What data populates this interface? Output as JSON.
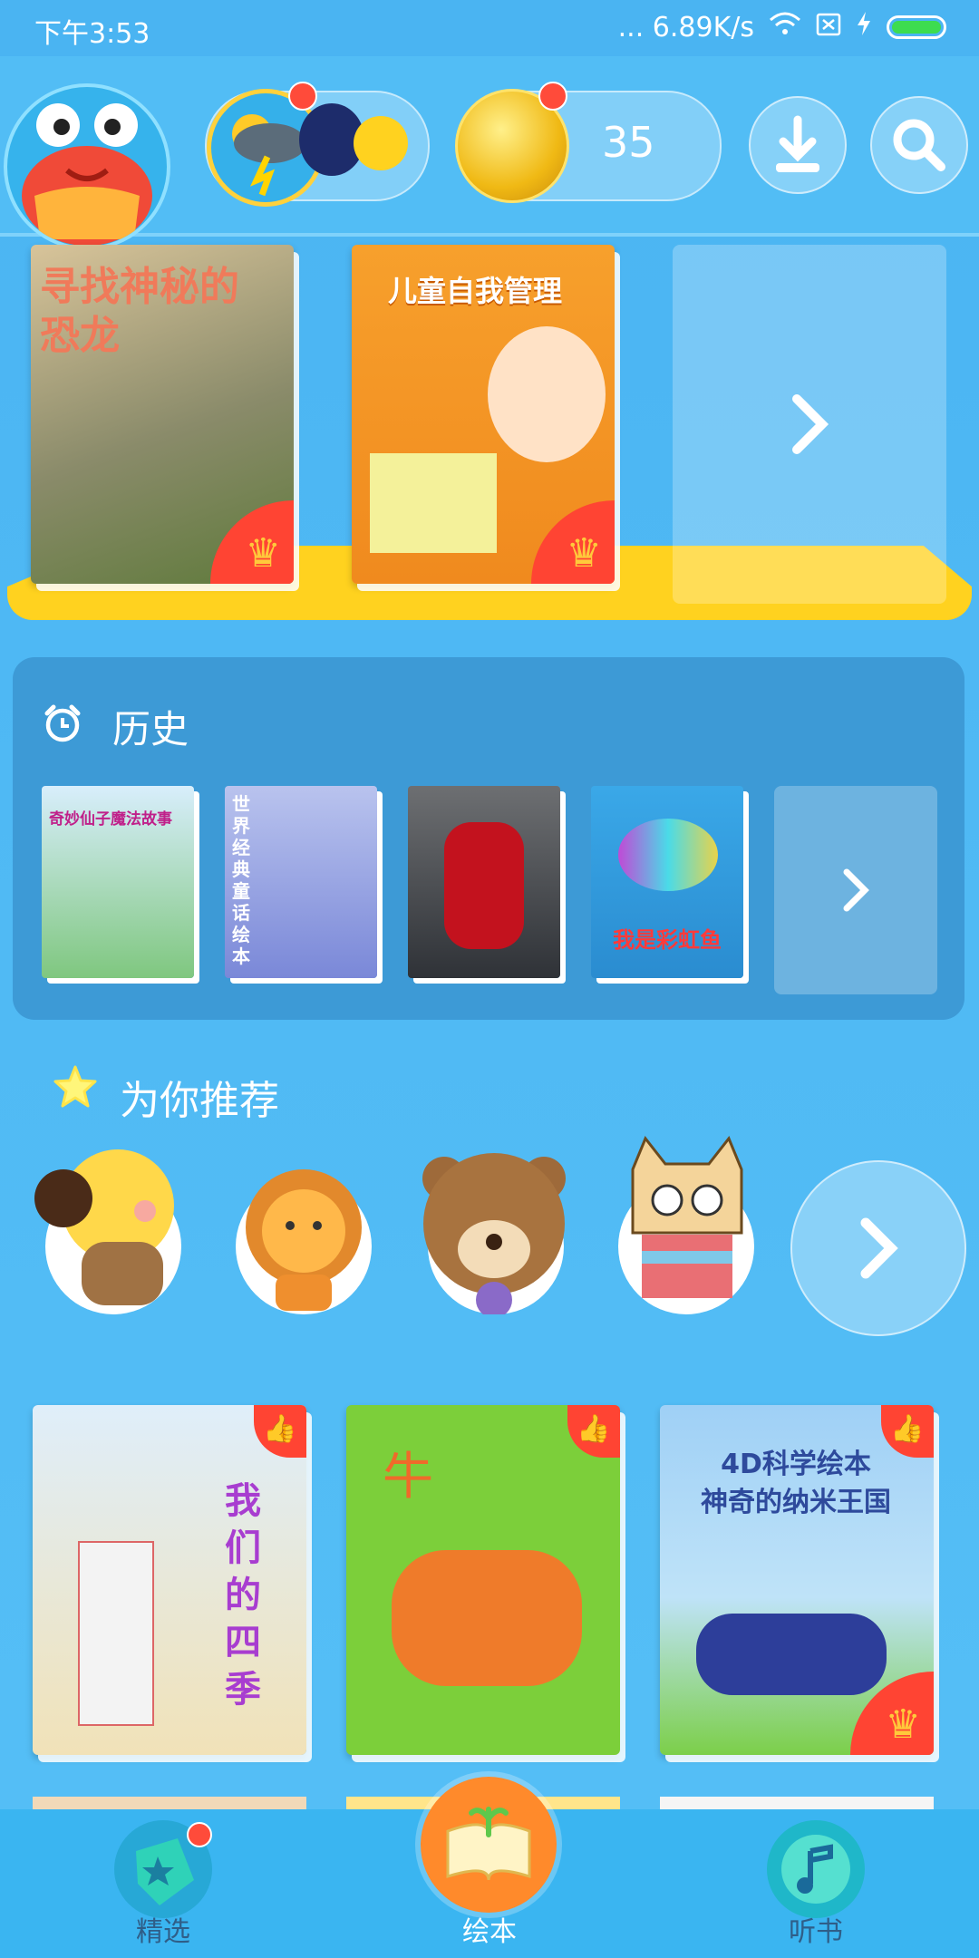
{
  "status": {
    "time": "下午3:53",
    "network": "... 6.89K/s",
    "icons": [
      "wifi-icon",
      "sim-icon",
      "charging-icon",
      "battery-icon"
    ]
  },
  "header": {
    "coins": "35",
    "avatar_icon": "crab-avatar-icon",
    "weather_icon": "weather-badge-icon",
    "download_icon": "download-icon",
    "search_icon": "search-icon"
  },
  "shelf": {
    "books": [
      {
        "title": "寻找神秘的恐龙",
        "badge": "crown-icon"
      },
      {
        "title": "儿童自我管理",
        "badge": "crown-icon"
      }
    ],
    "more_icon": "chevron-right-icon"
  },
  "history": {
    "title": "历史",
    "icon": "alarm-clock-icon",
    "books": [
      {
        "title": "奇妙仙子魔法故事"
      },
      {
        "title": "世界经典童话绘本"
      },
      {
        "title": ""
      },
      {
        "title": "我是彩虹鱼"
      }
    ]
  },
  "recommend": {
    "title": "为你推荐",
    "icon": "star-icon",
    "characters": [
      "dog-character-icon",
      "lion-character-icon",
      "bear-character-icon",
      "cat-character-icon"
    ],
    "books": [
      {
        "title": "我们的四季",
        "badge": "thumbs-up-icon"
      },
      {
        "title": "牛",
        "badge": "thumbs-up-icon"
      },
      {
        "title": "4D科学绘本\n神奇的纳米王国",
        "line1": "4D科学绘本",
        "line2": "神奇的纳米王国",
        "badge": "thumbs-up-icon"
      }
    ]
  },
  "nav": {
    "items": [
      {
        "label": "精选",
        "icon": "featured-tag-icon",
        "active": false
      },
      {
        "label": "绘本",
        "icon": "picture-book-icon",
        "active": true
      },
      {
        "label": "听书",
        "icon": "audio-book-icon",
        "active": false
      }
    ]
  }
}
